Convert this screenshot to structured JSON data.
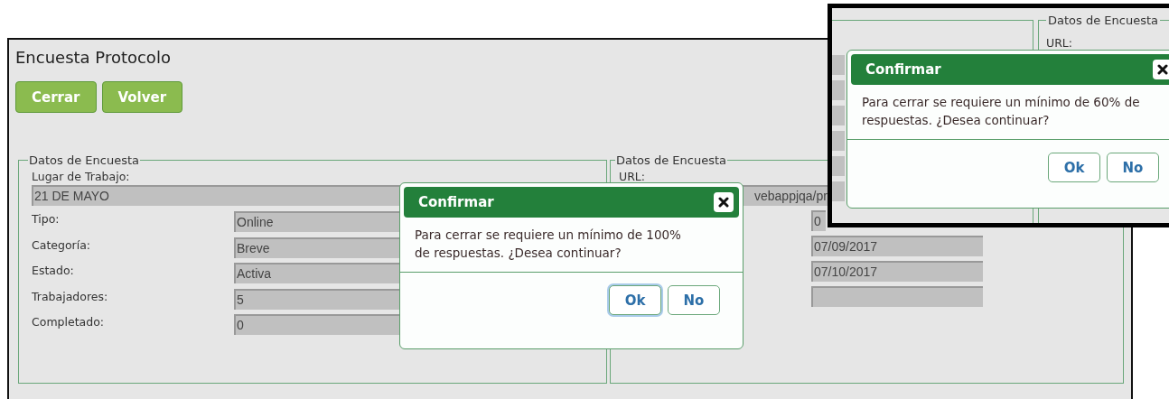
{
  "window": {
    "title": "Encuesta Protocolo"
  },
  "toolbar": {
    "buttons": [
      "Cerrar",
      "Volver"
    ]
  },
  "left_panel": {
    "legend": "Datos de Encuesta",
    "workplace": {
      "label": "Lugar de Trabajo:",
      "value": "21 DE MAYO"
    },
    "fields": [
      {
        "label": "Tipo:",
        "value": "Online"
      },
      {
        "label": "Categoría:",
        "value": "Breve"
      },
      {
        "label": "Estado:",
        "value": "Activa"
      },
      {
        "label": "Trabajadores:",
        "value": "5"
      },
      {
        "label": "Completado:",
        "value": "0"
      }
    ]
  },
  "right_panel": {
    "legend": "Datos de Encuesta",
    "url": {
      "label": "URL:",
      "value": "vebappjqa/pr"
    },
    "fields": [
      {
        "kind": "text",
        "value": "0"
      },
      {
        "kind": "text",
        "value": "07/09/2017"
      },
      {
        "kind": "text",
        "value": "07/10/2017"
      },
      {
        "kind": "blank"
      }
    ]
  },
  "dialog": {
    "title": "Confirmar",
    "message": "Para cerrar se requiere un mínimo de 100% de respuestas. ¿Desea continuar?",
    "buttons": [
      {
        "label": "Ok",
        "focused": true
      },
      {
        "label": "No",
        "focused": false
      }
    ]
  },
  "inset": {
    "legend": "Datos de Encuesta",
    "url_label": "URL:",
    "dialog": {
      "title": "Confirmar",
      "message": "Para cerrar se requiere un mínimo de 60% de respuestas. ¿Desea continuar?",
      "buttons": [
        {
          "label": "Ok",
          "focused": false
        },
        {
          "label": "No",
          "focused": false
        }
      ]
    }
  }
}
